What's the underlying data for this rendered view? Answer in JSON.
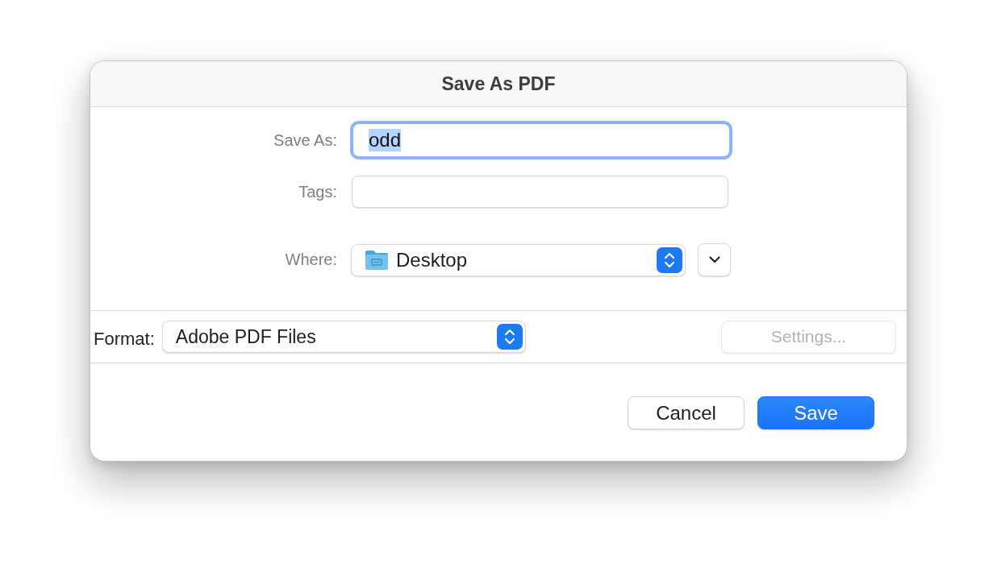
{
  "dialog": {
    "title": "Save As PDF"
  },
  "save_as": {
    "label": "Save As:",
    "value": "odd",
    "focused": true,
    "text_highlighted": true
  },
  "tags": {
    "label": "Tags:"
  },
  "where": {
    "label": "Where:",
    "value": "Desktop",
    "expanded": false
  },
  "format": {
    "label": "Format:",
    "value": "Adobe PDF Files"
  },
  "settings_button": {
    "label": "Settings...",
    "disabled": true
  },
  "buttons": [
    {
      "label": "Cancel",
      "default": false
    },
    {
      "label": "Save",
      "default": true
    }
  ]
}
